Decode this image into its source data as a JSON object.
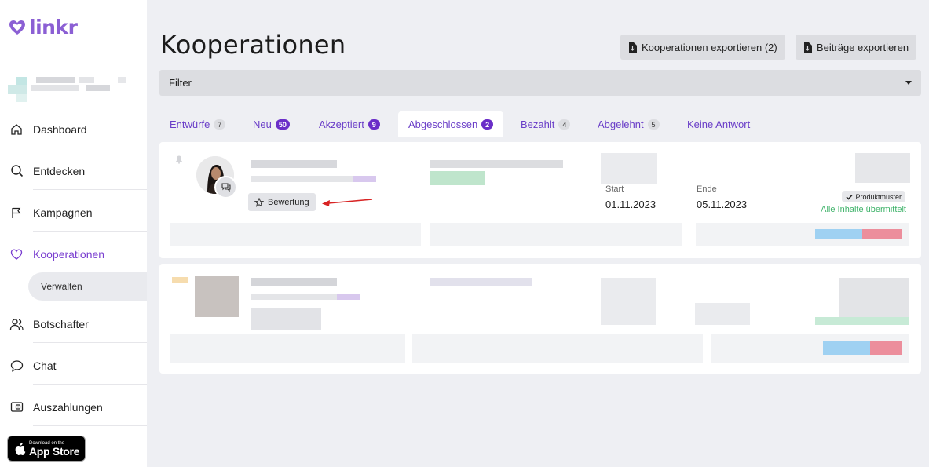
{
  "app": {
    "logo_text": "linkr",
    "brand_color": "#8b5fd4"
  },
  "sidebar": {
    "items": [
      {
        "label": "Dashboard",
        "icon": "home-icon"
      },
      {
        "label": "Entdecken",
        "icon": "search-icon"
      },
      {
        "label": "Kampagnen",
        "icon": "flag-icon"
      },
      {
        "label": "Kooperationen",
        "icon": "heart-icon",
        "active": true
      },
      {
        "label": "Botschafter",
        "icon": "users-icon"
      },
      {
        "label": "Chat",
        "icon": "chat-icon"
      },
      {
        "label": "Auszahlungen",
        "icon": "wallet-icon"
      }
    ],
    "subitem": "Verwalten",
    "appstore": {
      "small": "Download on the",
      "big": "App Store"
    }
  },
  "header": {
    "title": "Kooperationen",
    "export_coops": "Kooperationen exportieren (2)",
    "export_posts": "Beiträge exportieren"
  },
  "filter": {
    "label": "Filter"
  },
  "tabs": [
    {
      "label": "Entwürfe",
      "count": "7",
      "style": "grey"
    },
    {
      "label": "Neu",
      "count": "50",
      "style": "purple"
    },
    {
      "label": "Akzeptiert",
      "count": "9",
      "style": "purple"
    },
    {
      "label": "Abgeschlossen",
      "count": "2",
      "style": "purple",
      "active": true
    },
    {
      "label": "Bezahlt",
      "count": "4",
      "style": "grey"
    },
    {
      "label": "Abgelehnt",
      "count": "5",
      "style": "grey"
    },
    {
      "label": "Keine Antwort",
      "count": "",
      "style": "none"
    }
  ],
  "card1": {
    "rating_button": "Bewertung",
    "start_label": "Start",
    "start_value": "01.11.2023",
    "end_label": "Ende",
    "end_value": "05.11.2023",
    "product_badge": "Produktmuster",
    "status": "Alle Inhalte übermittelt"
  }
}
